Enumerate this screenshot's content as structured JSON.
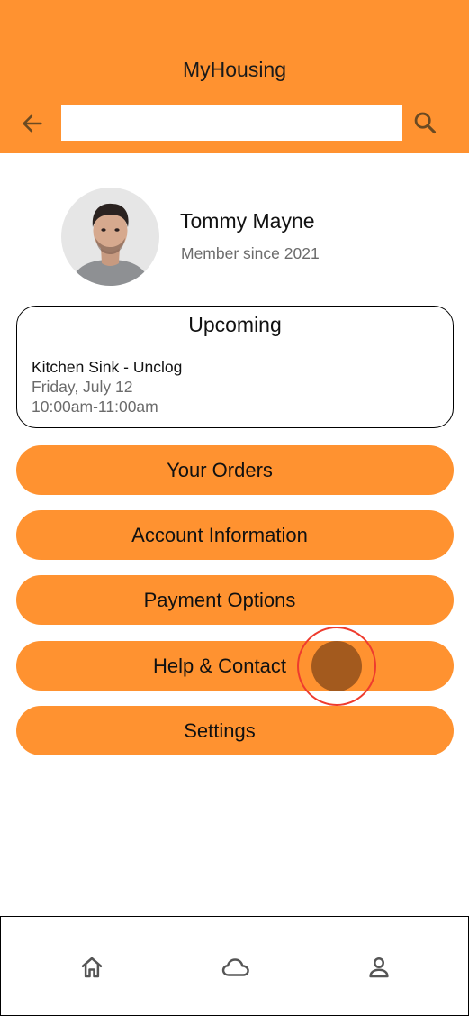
{
  "app": {
    "title": "MyHousing"
  },
  "header": {
    "back_icon": "arrow-left-icon",
    "search_placeholder": "",
    "search_value": "",
    "search_icon": "search-icon"
  },
  "profile": {
    "name": "Tommy Mayne",
    "subtitle": "Member since 2021"
  },
  "upcoming": {
    "title": "Upcoming",
    "task": "Kitchen Sink - Unclog",
    "date": "Friday, July 12",
    "time": "10:00am-11:00am"
  },
  "menu": {
    "items": [
      {
        "label": "Your Orders"
      },
      {
        "label": "Account Information"
      },
      {
        "label": "Payment Options"
      },
      {
        "label": "Help & Contact"
      },
      {
        "label": "Settings"
      }
    ]
  },
  "bottom_nav": {
    "items": [
      {
        "icon": "home-icon"
      },
      {
        "icon": "cloud-icon"
      },
      {
        "icon": "person-icon"
      }
    ]
  },
  "colors": {
    "accent": "#FF9230",
    "touch_ring": "#EE3B2E",
    "touch_dot": "#A35A1E",
    "muted_text": "#6b6b6b"
  }
}
